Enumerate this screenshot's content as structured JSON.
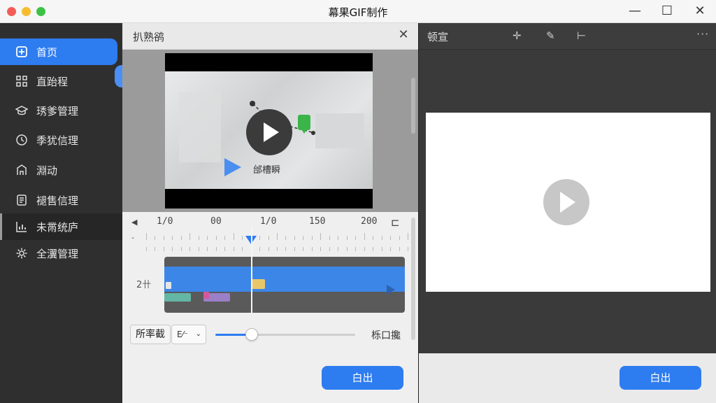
{
  "window": {
    "title": "幕果GIF制作",
    "min_icon": "minimize-icon",
    "max_icon": "maximize-icon",
    "close_icon": "close-icon"
  },
  "sidebar": {
    "items": [
      {
        "label": "首页",
        "icon": "home-icon",
        "state": "active"
      },
      {
        "label": "直跆程",
        "icon": "grid-icon"
      },
      {
        "label": "琇爹管理",
        "icon": "cap-icon"
      },
      {
        "label": "季犹信理",
        "icon": "clock-icon"
      },
      {
        "label": "淵动",
        "icon": "building-icon"
      },
      {
        "label": "褪售信理",
        "icon": "document-icon"
      },
      {
        "label": "未黹统庐",
        "icon": "chart-icon",
        "state": "selected"
      },
      {
        "label": "全瀷管理",
        "icon": "gear-icon"
      }
    ]
  },
  "editor": {
    "title": "扒熟鹆",
    "video_label": "邰槽瞬",
    "ruler_labels": [
      "1/0",
      "00",
      "1/0",
      "150",
      "200"
    ],
    "ruler_minus": "-",
    "track_label": "2卄",
    "playhead_fraction": 0.36,
    "controls": {
      "option_button": "所率截",
      "select_value": "E⁄⁻",
      "slider_value": 0.26,
      "slider_label": "栎口攙"
    },
    "export_button": "白出"
  },
  "preview": {
    "title": "顿宣",
    "more": "···",
    "export_button": "白出"
  },
  "colors": {
    "accent": "#2d7cf0",
    "sidebar_bg": "#2f2f2f",
    "preview_bg": "#3a3a3a"
  }
}
